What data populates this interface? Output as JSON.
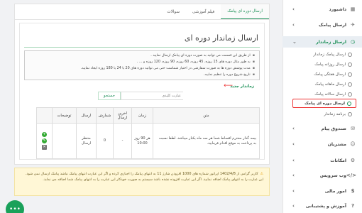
{
  "sidebar": {
    "items": [
      {
        "label": "داشبورد",
        "icon": "dashboard-icon",
        "glyph": "▦",
        "chev": "›"
      },
      {
        "label": "ارسال پیامک",
        "icon": "send-sms-icon",
        "glyph": "✈",
        "chev": "›"
      },
      {
        "label": "ارسال زماندار",
        "icon": "clock-icon",
        "glyph": "◷",
        "chev": "⌄"
      },
      {
        "label": "صندوق پیام",
        "icon": "inbox-icon",
        "glyph": "✉",
        "chev": "›"
      },
      {
        "label": "مشتریان",
        "icon": "customers-icon",
        "glyph": "☺",
        "chev": "›"
      },
      {
        "label": "امکانات",
        "icon": "features-icon",
        "glyph": "⚙",
        "chev": "›"
      },
      {
        "label": "وب سرویس",
        "icon": "code-icon",
        "glyph": "</>",
        "chev": "›"
      },
      {
        "label": "امور مالی",
        "icon": "finance-icon",
        "glyph": "$",
        "chev": "›"
      },
      {
        "label": "آموزش و پشتیبانی",
        "icon": "support-icon",
        "glyph": "?",
        "chev": "›"
      }
    ],
    "sub_items": [
      "ارسال پیامک زماندار",
      "ارسال روزانه پیامک",
      "ارسال هفتگی پیامک",
      "ارسال ماهانه پیامک",
      "ارسال سالانه پیامک",
      "ارسال دوره ای پیامک",
      "برنامه زماندار"
    ]
  },
  "tabs": [
    "ارسال دوره ای پیامک",
    "فیلم آموزشی",
    "سوالات"
  ],
  "page": {
    "title": "ارسال زماندار دوره ای",
    "info": [
      "از طریق این قسمت می توانید به صورت دوره ای پیامک ارسال نمایید .",
      "به طور مثال دوره های 15 روزه، 45 روزه، 60 روزه، 90 روزه، 120 روزه و ... .",
      "مدت پوشش دوره ها به صورت سفارشی در اختیار شماست حتی می توانید دوره های 20 یا 24 یا 180 روزه ایجاد نمایید.",
      "تاریخ شروع دوره را تنظیم نمایید."
    ],
    "new_link": "زماندار جدید",
    "search_placeholder": "عبارت کلیدی",
    "search_button": "جستجو"
  },
  "table": {
    "headers": [
      "متن",
      "زمان",
      "اخرین ارسال",
      "شمارش",
      "ارسال",
      "توضیحات"
    ],
    "row": {
      "text": "بیمه گذار محترم اقساط شما هر سه ماه یکبار میباشد. لطفا نسبت به پرداخت به موقع اقدام فرمایید.",
      "time": "هر 90 روز 10:00",
      "last_sent": "-",
      "count": "0",
      "status": "منتظر ارسال",
      "desc": ""
    },
    "page_number": "0"
  },
  "note": "کاربر گرامی از 1402/4/8 اپراتور شماره های 1000 افزودن شارژ 11 به انتهای پیامک را اجباری کرده و اگر این عبارت انتهای پیامک نباشد پیامک ارسال نمی شود. این عبارت را به انتهای پیامک اضافه نمایید. اگر این عبارت افزوده نشده باشد سیستم به صورت خودکار این عبارت را به انتهای پیامک شما اضافه می نماید.",
  "colors": {
    "accent": "#1a8f56",
    "highlight": "#e33333",
    "note_bg": "#fff7d6"
  }
}
